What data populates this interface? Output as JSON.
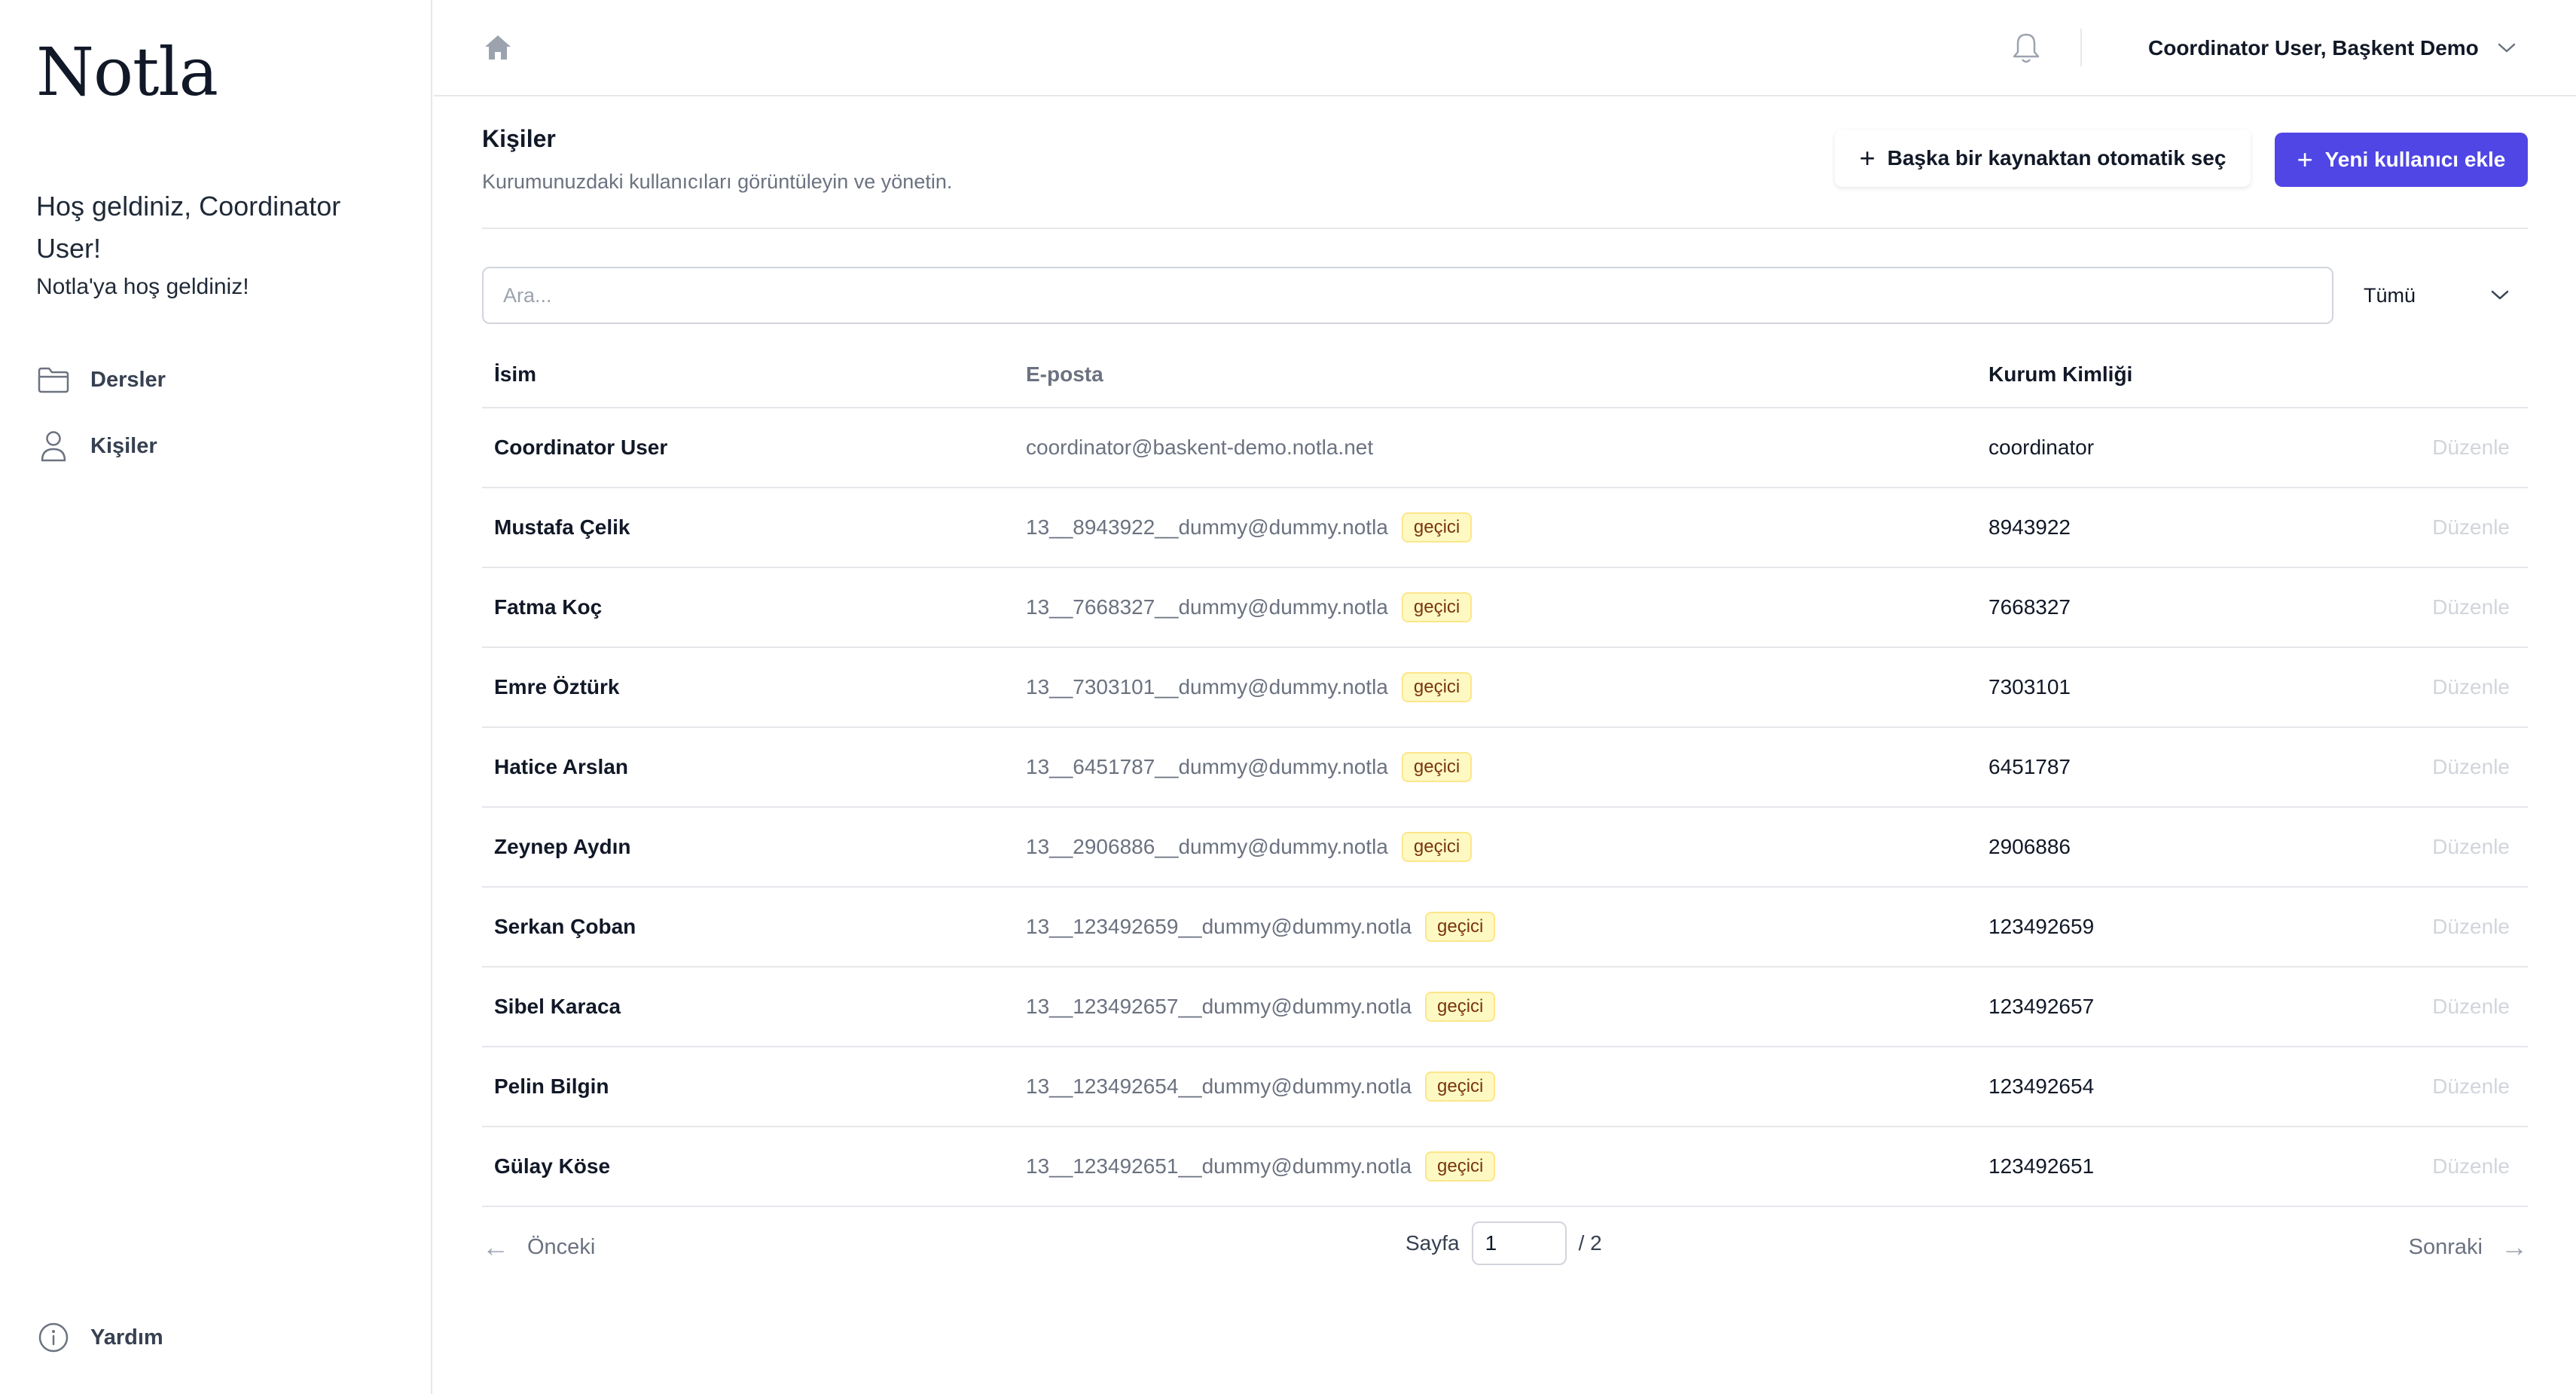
{
  "sidebar": {
    "logo": "Notla",
    "welcome": "Hoş geldiniz, Coordinator User!",
    "welcome_sub": "Notla'ya hoş geldiniz!",
    "nav": [
      {
        "label": "Dersler",
        "icon": "folder-icon"
      },
      {
        "label": "Kişiler",
        "icon": "user-icon"
      }
    ],
    "help": {
      "label": "Yardım",
      "icon": "info-icon"
    }
  },
  "topbar": {
    "user_menu_label": "Coordinator User, Başkent Demo"
  },
  "page": {
    "title": "Kişiler",
    "subtitle": "Kurumunuzdaki kullanıcıları görüntüleyin ve yönetin.",
    "auto_select_label": "Başka bir kaynaktan otomatik seç",
    "add_user_label": "Yeni kullanıcı ekle"
  },
  "search": {
    "placeholder": "Ara...",
    "value": ""
  },
  "filter": {
    "selected": "Tümü"
  },
  "table": {
    "headers": {
      "name": "İsim",
      "email": "E-posta",
      "id": "Kurum Kimliği"
    },
    "rows": [
      {
        "name": "Coordinator User",
        "email": "coordinator@baskent-demo.notla.net",
        "badge": "",
        "id": "coordinator",
        "action": "Düzenle"
      },
      {
        "name": "Mustafa Çelik",
        "email": "13__8943922__dummy@dummy.notla",
        "badge": "geçici",
        "id": "8943922",
        "action": "Düzenle"
      },
      {
        "name": "Fatma Koç",
        "email": "13__7668327__dummy@dummy.notla",
        "badge": "geçici",
        "id": "7668327",
        "action": "Düzenle"
      },
      {
        "name": "Emre Öztürk",
        "email": "13__7303101__dummy@dummy.notla",
        "badge": "geçici",
        "id": "7303101",
        "action": "Düzenle"
      },
      {
        "name": "Hatice Arslan",
        "email": "13__6451787__dummy@dummy.notla",
        "badge": "geçici",
        "id": "6451787",
        "action": "Düzenle"
      },
      {
        "name": "Zeynep Aydın",
        "email": "13__2906886__dummy@dummy.notla",
        "badge": "geçici",
        "id": "2906886",
        "action": "Düzenle"
      },
      {
        "name": "Serkan Çoban",
        "email": "13__123492659__dummy@dummy.notla",
        "badge": "geçici",
        "id": "123492659",
        "action": "Düzenle"
      },
      {
        "name": "Sibel Karaca",
        "email": "13__123492657__dummy@dummy.notla",
        "badge": "geçici",
        "id": "123492657",
        "action": "Düzenle"
      },
      {
        "name": "Pelin Bilgin",
        "email": "13__123492654__dummy@dummy.notla",
        "badge": "geçici",
        "id": "123492654",
        "action": "Düzenle"
      },
      {
        "name": "Gülay Köse",
        "email": "13__123492651__dummy@dummy.notla",
        "badge": "geçici",
        "id": "123492651",
        "action": "Düzenle"
      }
    ]
  },
  "pagination": {
    "prev_label": "Önceki",
    "next_label": "Sonraki",
    "page_label": "Sayfa",
    "current_page": "1",
    "total_label": "/ 2"
  },
  "colors": {
    "accent": "#4f46e5",
    "badge_bg": "#fef9c3",
    "badge_text": "#78350f"
  }
}
